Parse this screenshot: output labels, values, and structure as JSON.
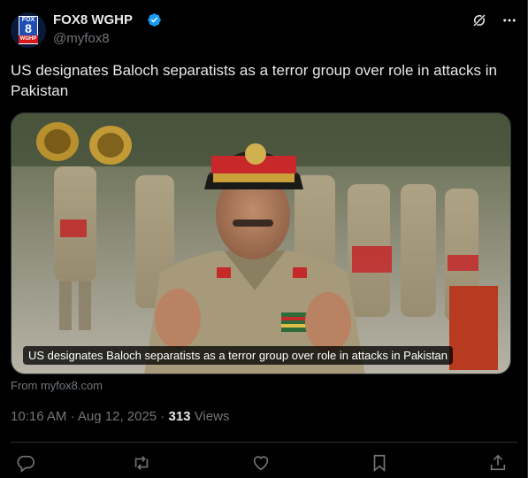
{
  "author": {
    "name": "FOX8 WGHP",
    "handle": "@myfox8",
    "verified": true,
    "avatar_text": {
      "top": "FOX",
      "number": "8",
      "bottom": "WGHP"
    }
  },
  "header_icons": [
    "grok-icon",
    "more-icon"
  ],
  "tweet": {
    "text": "US designates Baloch separatists as a terror group over role in attacks in Pakistan"
  },
  "media": {
    "caption": "US designates Baloch separatists as a terror group over role in attacks in Pakistan",
    "source": "From myfox8.com"
  },
  "meta": {
    "time": "10:16 AM",
    "separator": "·",
    "date": "Aug 12, 2025",
    "views_count": "313",
    "views_label": "Views"
  },
  "actions": [
    "reply-icon",
    "retweet-icon",
    "like-icon",
    "bookmark-icon",
    "share-icon"
  ],
  "colors": {
    "background": "#000000",
    "text_primary": "#e7e9ea",
    "text_secondary": "#71767b",
    "verified_blue": "#1d9bf0",
    "border": "#2f3336"
  }
}
